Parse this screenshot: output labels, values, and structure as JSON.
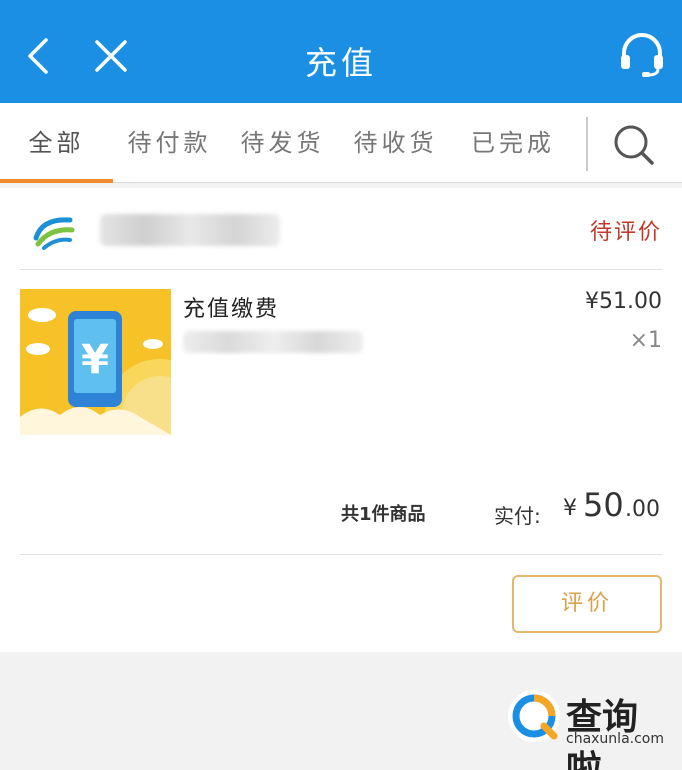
{
  "header": {
    "title": "充值",
    "back_icon": "back-arrow-icon",
    "close_icon": "close-icon",
    "support_icon": "headset-icon"
  },
  "tabs": [
    {
      "label": "全部",
      "active": true
    },
    {
      "label": "待付款",
      "active": false
    },
    {
      "label": "待发货",
      "active": false
    },
    {
      "label": "待收货",
      "active": false
    },
    {
      "label": "已完成",
      "active": false
    }
  ],
  "order": {
    "status": "待评价",
    "product": {
      "name": "充值缴费",
      "unit_price": "¥51.00",
      "quantity": "×1"
    },
    "count_label": "共1件商品",
    "paid_label": "实付:",
    "paid_currency": "¥",
    "paid_integer": "50",
    "paid_decimal": ".00",
    "rate_button": "评价"
  },
  "watermark": {
    "text": "查询啦",
    "url": "chaxunla.com"
  },
  "colors": {
    "header_bg": "#1a8fe3",
    "tab_active_underline": "#f08a2c",
    "status_text": "#c0392b",
    "rate_button_border": "#e2b86c"
  }
}
